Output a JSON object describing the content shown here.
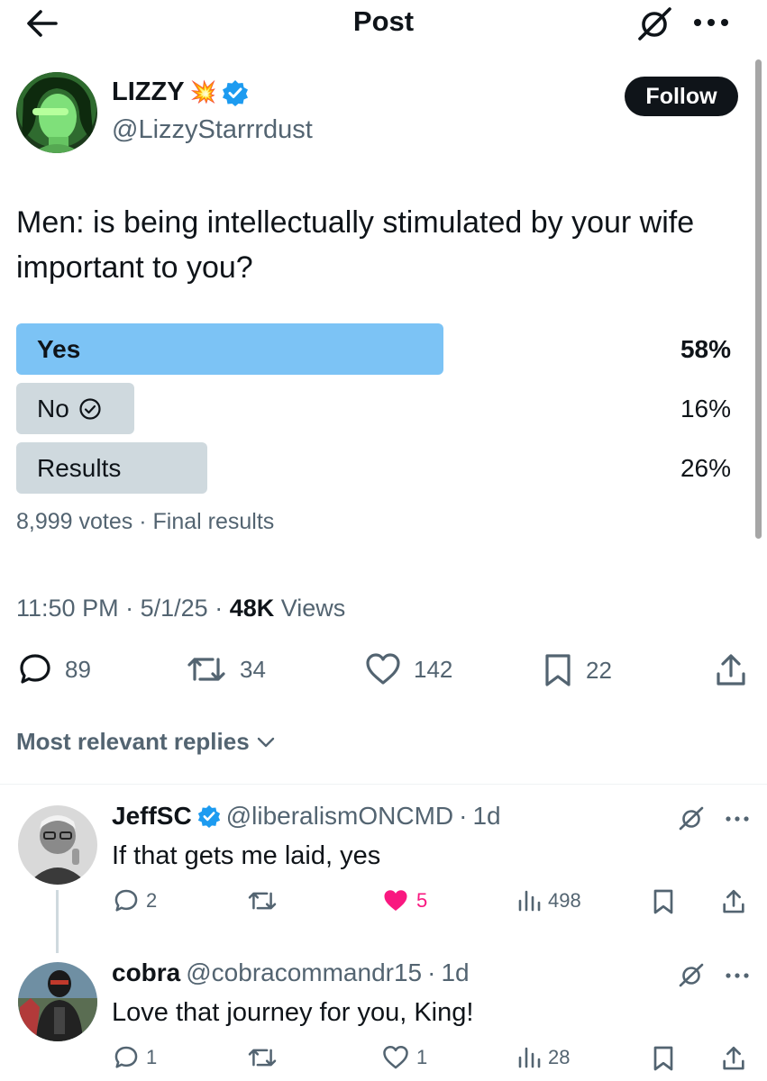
{
  "header": {
    "title": "Post"
  },
  "author": {
    "name": "LIZZY",
    "name_emoji": "💥",
    "handle": "@LizzyStarrrdust",
    "follow_label": "Follow"
  },
  "post": {
    "text": "Men: is being intellectually stimulated by your wife important to you?"
  },
  "poll": {
    "options": [
      {
        "label": "Yes",
        "percent_text": "58%",
        "percent": 58,
        "leading": true
      },
      {
        "label": "No",
        "percent_text": "16%",
        "percent": 16,
        "voted": true
      },
      {
        "label": "Results",
        "percent_text": "26%",
        "percent": 26
      }
    ],
    "votes": "8,999 votes",
    "separator": "·",
    "status": "Final results",
    "colors": {
      "leading": "#7cc3f5",
      "other": "#cfd9de"
    }
  },
  "meta": {
    "time": "11:50 PM",
    "sep": "·",
    "date": "5/1/25",
    "views_count": "48K",
    "views_label": "Views"
  },
  "actions": {
    "replies": "89",
    "reposts": "34",
    "likes": "142",
    "bookmarks": "22"
  },
  "sort": {
    "label": "Most relevant replies"
  },
  "replies": [
    {
      "name": "JeffSC",
      "verified": true,
      "handle": "@liberalismONCMD",
      "sep": "·",
      "age": "1d",
      "text": "If that gets me laid, yes",
      "replies": "2",
      "likes": "5",
      "liked": true,
      "views": "498"
    },
    {
      "name": "cobra",
      "verified": false,
      "handle": "@cobracommandr15",
      "sep": "·",
      "age": "1d",
      "text": "Love that journey for you, King!",
      "replies": "1",
      "likes": "1",
      "liked": false,
      "views": "28"
    }
  ],
  "colors": {
    "text": "#0f1419",
    "muted": "#536471",
    "verified": "#1d9bf0",
    "like_active": "#f91880"
  }
}
